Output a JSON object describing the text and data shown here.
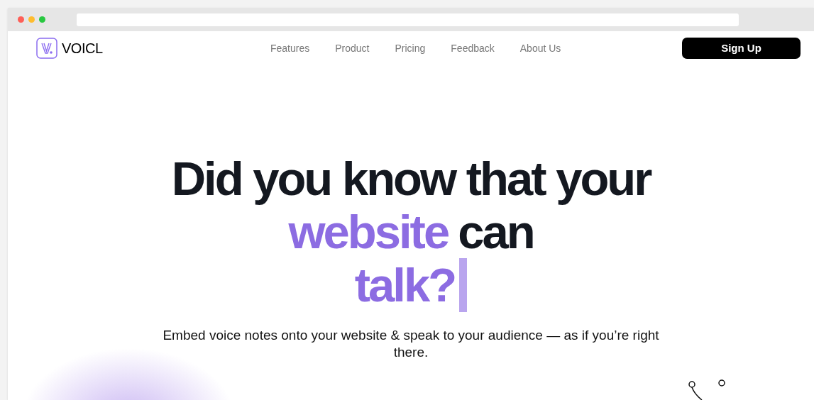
{
  "nav": {
    "brand": "VOICL",
    "links": [
      {
        "label": "Features"
      },
      {
        "label": "Product"
      },
      {
        "label": "Pricing"
      },
      {
        "label": "Feedback"
      },
      {
        "label": "About Us"
      }
    ],
    "cta": "Sign Up"
  },
  "hero": {
    "headline": [
      [
        {
          "text": "Did you know that your",
          "accent": false
        }
      ],
      [
        {
          "text": "website",
          "accent": true
        },
        {
          "text": "can",
          "accent": false
        }
      ],
      [
        {
          "text": "talk?",
          "accent": true
        }
      ]
    ],
    "cursor": true,
    "subtitle": "Embed voice notes onto your website & speak to your audience — as if you’re right there."
  }
}
